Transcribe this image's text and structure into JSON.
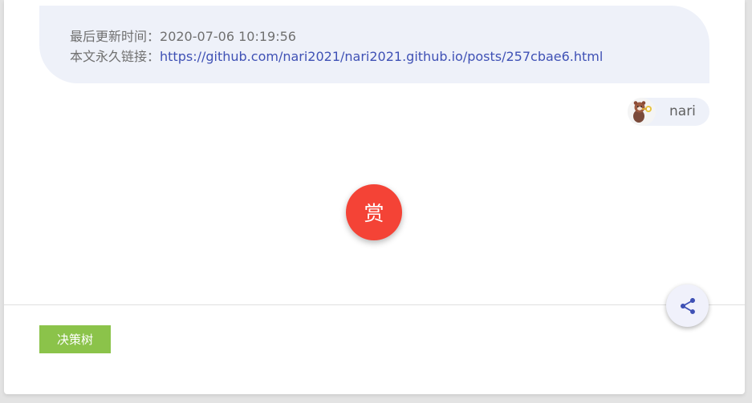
{
  "copyright": {
    "updated_label": "最后更新时间：",
    "updated_value": "2020-07-06 10:19:56",
    "permalink_label": "本文永久链接：",
    "permalink_url": "https://github.com/nari2021/nari2021.github.io/posts/257cbae6.html"
  },
  "author": {
    "name": "nari",
    "avatar_icon": "red-panda-avatar"
  },
  "reward": {
    "label": "赏",
    "color": "#f44336"
  },
  "share": {
    "icon": "share-icon",
    "color": "#3f51b5"
  },
  "tags": [
    {
      "label": "决策树",
      "color": "#8bc34a"
    }
  ]
}
